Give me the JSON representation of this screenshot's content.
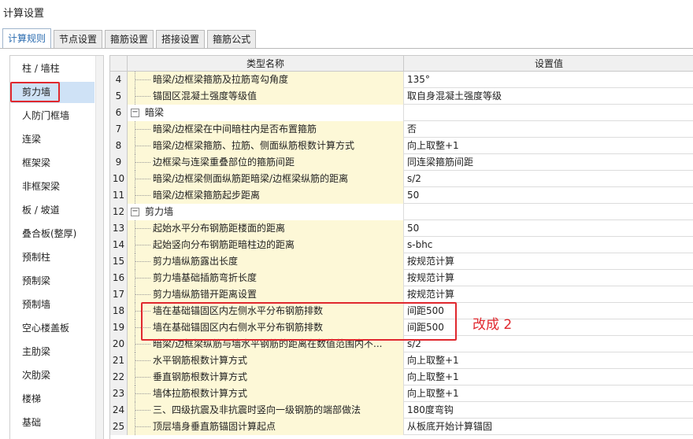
{
  "window": {
    "title": "计算设置"
  },
  "tabs": [
    {
      "label": "计算规则",
      "active": true
    },
    {
      "label": "节点设置",
      "active": false
    },
    {
      "label": "箍筋设置",
      "active": false
    },
    {
      "label": "搭接设置",
      "active": false
    },
    {
      "label": "箍筋公式",
      "active": false
    }
  ],
  "sidebar": {
    "items": [
      {
        "label": "柱 / 墙柱"
      },
      {
        "label": "剪力墙",
        "selected": true
      },
      {
        "label": "人防门框墙"
      },
      {
        "label": "连梁"
      },
      {
        "label": "框架梁"
      },
      {
        "label": "非框架梁"
      },
      {
        "label": "板 / 坡道"
      },
      {
        "label": "叠合板(整厚)"
      },
      {
        "label": "预制柱"
      },
      {
        "label": "预制梁"
      },
      {
        "label": "预制墙"
      },
      {
        "label": "空心楼盖板"
      },
      {
        "label": "主肋梁"
      },
      {
        "label": "次肋梁"
      },
      {
        "label": "楼梯"
      },
      {
        "label": "基础"
      }
    ]
  },
  "grid": {
    "columns": {
      "name": "类型名称",
      "value": "设置值"
    },
    "rows": [
      {
        "num": "4",
        "name": "暗梁/边框梁箍筋及拉筋弯勾角度",
        "value": "135°"
      },
      {
        "num": "5",
        "name": "锚固区混凝土强度等级值",
        "value": "取自身混凝土强度等级"
      },
      {
        "num": "6",
        "name": "暗梁",
        "value": "",
        "group": true,
        "expander": "−"
      },
      {
        "num": "7",
        "name": "暗梁/边框梁在中间暗柱内是否布置箍筋",
        "value": "否"
      },
      {
        "num": "8",
        "name": "暗梁/边框梁箍筋、拉筋、侧面纵筋根数计算方式",
        "value": "向上取整+1"
      },
      {
        "num": "9",
        "name": "边框梁与连梁重叠部位的箍筋间距",
        "value": "同连梁箍筋间距"
      },
      {
        "num": "10",
        "name": "暗梁/边框梁侧面纵筋距暗梁/边框梁纵筋的距离",
        "value": "s/2"
      },
      {
        "num": "11",
        "name": "暗梁/边框梁箍筋起步距离",
        "value": "50"
      },
      {
        "num": "12",
        "name": "剪力墙",
        "value": "",
        "group": true,
        "expander": "−"
      },
      {
        "num": "13",
        "name": "起始水平分布钢筋距楼面的距离",
        "value": "50"
      },
      {
        "num": "14",
        "name": "起始竖向分布钢筋距暗柱边的距离",
        "value": "s-bhc"
      },
      {
        "num": "15",
        "name": "剪力墙纵筋露出长度",
        "value": "按规范计算"
      },
      {
        "num": "16",
        "name": "剪力墙基础插筋弯折长度",
        "value": "按规范计算"
      },
      {
        "num": "17",
        "name": "剪力墙纵筋错开距离设置",
        "value": "按规范计算"
      },
      {
        "num": "18",
        "name": "墙在基础锚固区内左侧水平分布钢筋排数",
        "value": "间距500"
      },
      {
        "num": "19",
        "name": "墙在基础锚固区内右侧水平分布钢筋排数",
        "value": "间距500"
      },
      {
        "num": "20",
        "name": "暗梁/边框梁纵筋与墙水平钢筋的距离在数值范围内不...",
        "value": "s/2"
      },
      {
        "num": "21",
        "name": "水平钢筋根数计算方式",
        "value": "向上取整+1"
      },
      {
        "num": "22",
        "name": "垂直钢筋根数计算方式",
        "value": "向上取整+1"
      },
      {
        "num": "23",
        "name": "墙体拉筋根数计算方式",
        "value": "向上取整+1"
      },
      {
        "num": "24",
        "name": "三、四级抗震及非抗震时竖向一级钢筋的端部做法",
        "value": "180度弯钩"
      },
      {
        "num": "25",
        "name": "顶层墙身垂直筋锚固计算起点",
        "value": "从板底开始计算锚固"
      }
    ]
  },
  "annotation": {
    "text": "改成 2",
    "color": "#e0282e"
  }
}
